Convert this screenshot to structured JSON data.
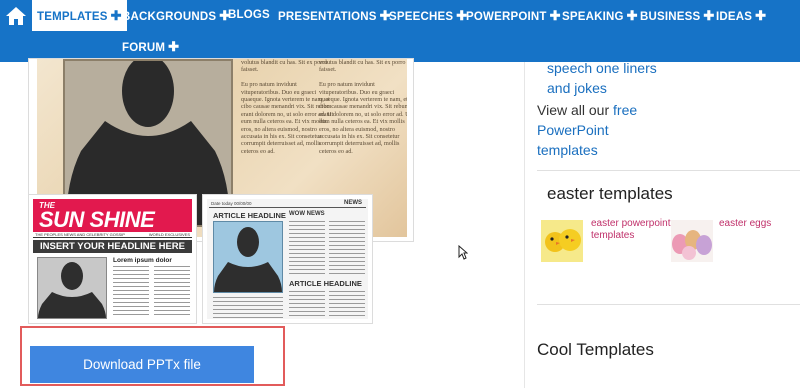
{
  "nav": {
    "items": [
      {
        "label": "TEMPLATES",
        "has_plus": true,
        "active": true
      },
      {
        "label": "BACKGROUNDS",
        "has_plus": true
      },
      {
        "label": "BLOGS",
        "has_plus": false
      },
      {
        "label": "PRESENTATIONS",
        "has_plus": true
      },
      {
        "label": "SPEECHES",
        "has_plus": true
      },
      {
        "label": "POWERPOINT",
        "has_plus": true
      },
      {
        "label": "SPEAKING",
        "has_plus": true
      },
      {
        "label": "BUSINESS",
        "has_plus": true
      },
      {
        "label": "IDEAS",
        "has_plus": true
      },
      {
        "label": "FORUM",
        "has_plus": true
      }
    ],
    "plus": "✚",
    "home_icon": "home-icon",
    "colors": {
      "bar": "#1673c7",
      "active_bg": "#ffffff",
      "active_text": "#1673c7"
    }
  },
  "templates": {
    "big_preview_text": "Eu pro natum invidunt vituperatoribus. Duo eu graeci quaeque. Ignota verterem te nam, et cibo causae menandri vix. Sit rebum erant dolorem no, ut solo error ad. Ut eum nulla ceteros ea. Et vix mollis eros, no altera euismod, nostro accusata in his ex. Sit consetetur corrumpit deterruisset ad, mollis ceteros eo ad.",
    "big_preview_top_left": "volutus blandit cu has. Sit ex porro faisset.",
    "sun_shine": {
      "the": "THE",
      "title": "SUN SHINE",
      "strap": "THE PEOPLES NEWS AND CELEBRITY GOSSIP",
      "strap_right": "WORLD EXCLUSIVES",
      "headline": "INSERT YOUR HEADLINE HERE",
      "article_title": "Lorem ipsum dolor"
    },
    "wow_news": {
      "date": "Date today 00/00/00",
      "masthead": "NEWS",
      "headline_1": "ARTICLE HEADLINE",
      "wow": "WOW NEWS",
      "headline_2": "ARTICLE HEADLINE"
    }
  },
  "download": {
    "label": "Download PPTx file",
    "color": "#3f86e0",
    "outline_color": "#e25b5b"
  },
  "sidebar": {
    "speech_link": "speech one liners\nand jokes",
    "speech_line1": "speech one liners",
    "speech_line2": "and jokes",
    "view_all_prefix": "View all our",
    "view_all_link_1": "free",
    "view_all_link_2": "PowerPoint",
    "view_all_link_3": "templates",
    "easter_heading": "easter templates",
    "easter_items": [
      {
        "label_line1": "easter powerpoint",
        "label_line2": "templates",
        "image": "yellow-chicks"
      },
      {
        "label_line1": "easter eggs",
        "label_line2": "",
        "image": "pastel-eggs"
      }
    ],
    "cool_heading": "Cool Templates",
    "link_color": "#1a6fbf",
    "easter_link_color": "#c0306a"
  }
}
